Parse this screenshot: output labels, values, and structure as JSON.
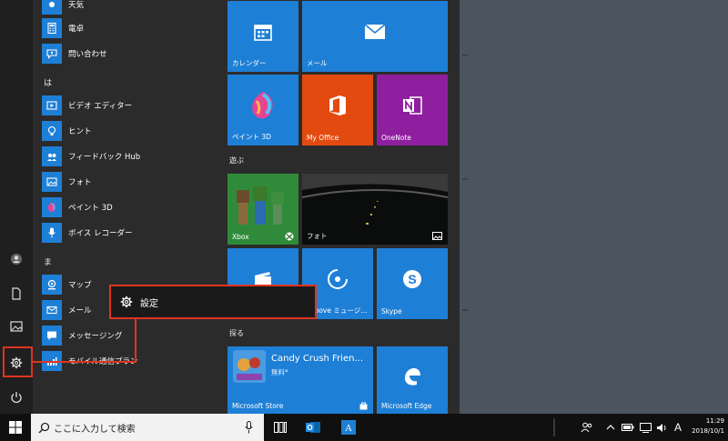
{
  "desktop": {},
  "rail": {
    "items": [
      "user-icon",
      "document-icon",
      "pictures-icon",
      "gear-icon",
      "power-icon"
    ]
  },
  "app_list": {
    "items": [
      {
        "label": "天気",
        "icon": "weather-icon"
      },
      {
        "label": "電卓",
        "icon": "calculator-icon"
      },
      {
        "label": "問い合わせ",
        "icon": "contact-support-icon"
      },
      {
        "label": "ビデオ エディター",
        "icon": "video-editor-icon"
      },
      {
        "label": "ヒント",
        "icon": "tips-icon"
      },
      {
        "label": "フィードバック Hub",
        "icon": "feedback-icon"
      },
      {
        "label": "フォト",
        "icon": "photos-icon"
      },
      {
        "label": "ペイント 3D",
        "icon": "paint3d-icon"
      },
      {
        "label": "ボイス レコーダー",
        "icon": "voice-recorder-icon"
      },
      {
        "label": "マップ",
        "icon": "maps-icon"
      },
      {
        "label": "メール",
        "icon": "mail-icon"
      },
      {
        "label": "メッセージング",
        "icon": "messaging-icon"
      },
      {
        "label": "モバイル通信プラン",
        "icon": "mobile-plans-icon"
      }
    ],
    "letters": [
      "は",
      "ま"
    ]
  },
  "tiles": {
    "calendar": "カレンダー",
    "mail": "メール",
    "paint3d": "ペイント 3D",
    "myoffice": "My Office",
    "onenote": "OneNote",
    "group_play": "遊ぶ",
    "xbox": "Xbox",
    "photos": "フォト",
    "groove": "Groove ミュージ...",
    "skype": "Skype",
    "group_explore": "探る",
    "candy_title": "Candy Crush Frien...",
    "candy_sub": "無料*",
    "store": "Microsoft Store",
    "edge": "Microsoft Edge"
  },
  "popup": {
    "label": "設定"
  },
  "taskbar": {
    "search_placeholder": "ここに入力して検索",
    "ime": "A",
    "time": "11:29",
    "date": "2018/10/1"
  }
}
